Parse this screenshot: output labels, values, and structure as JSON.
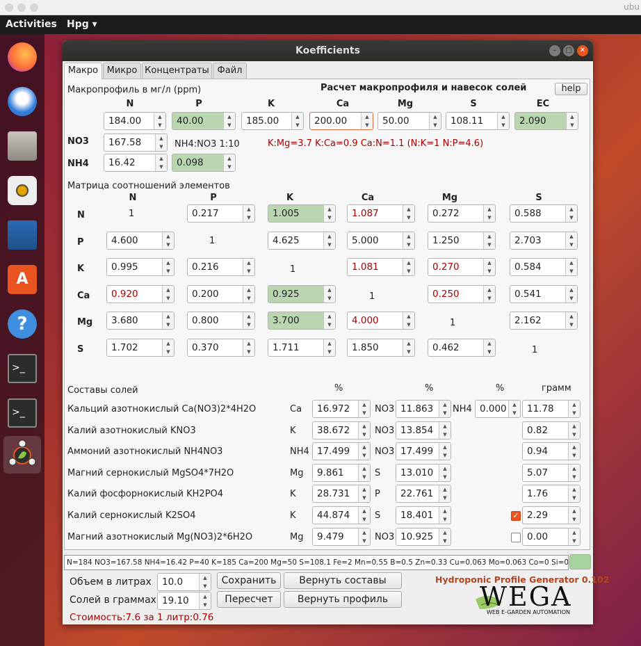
{
  "browser_chrome": {
    "title": "ubu"
  },
  "topbar": {
    "activities": "Activities",
    "app_menu": "Hpg ▾"
  },
  "dock": {
    "items": [
      "firefox-icon",
      "thunderbird-icon",
      "files-icon",
      "rhythmbox-icon",
      "writer-icon",
      "software-icon",
      "help-icon",
      "terminal-icon",
      "terminal-icon",
      "npk-app-icon"
    ]
  },
  "window": {
    "title": "Koefficients",
    "controls": [
      "–",
      "▢",
      "✕"
    ]
  },
  "tabs": [
    {
      "label": "Макро",
      "active": true
    },
    {
      "label": "Микро"
    },
    {
      "label": "Концентраты"
    },
    {
      "label": "Файл"
    }
  ],
  "macro": {
    "section_label": "Макропрофиль в мг/л (ppm)",
    "calc_title": "Расчет макропрофиля и навесок солей",
    "help_label": "help",
    "headers": [
      "N",
      "P",
      "K",
      "Ca",
      "Mg",
      "S",
      "EC"
    ],
    "values": [
      "184.00",
      "40.00",
      "185.00",
      "200.00",
      "50.00",
      "108.11",
      "2.090"
    ],
    "no3_label": "NO3",
    "no3_value": "167.58",
    "nh4_label": "NH4",
    "nh4_value": "16.42",
    "ratio_label": "NH4:NO3 1:10",
    "ratio_value": "0.098",
    "ratios_text": "K:Mg=3.7 K:Ca=0.9 Ca:N=1.1 (N:K=1 N:P=4.6)"
  },
  "matrix": {
    "title": "Матрица соотношений элементов",
    "cols": [
      "N",
      "P",
      "K",
      "Ca",
      "Mg",
      "S"
    ],
    "rows": [
      {
        "label": "N",
        "cells": [
          "1",
          "0.217",
          "1.005",
          "1.087",
          "0.272",
          "0.588"
        ]
      },
      {
        "label": "P",
        "cells": [
          "4.600",
          "1",
          "4.625",
          "5.000",
          "1.250",
          "2.703"
        ]
      },
      {
        "label": "K",
        "cells": [
          "0.995",
          "0.216",
          "1",
          "1.081",
          "0.270",
          "0.584"
        ]
      },
      {
        "label": "Ca",
        "cells": [
          "0.920",
          "0.200",
          "0.925",
          "1",
          "0.250",
          "0.541"
        ]
      },
      {
        "label": "Mg",
        "cells": [
          "3.680",
          "0.800",
          "3.700",
          "4.000",
          "1",
          "2.162"
        ]
      },
      {
        "label": "S",
        "cells": [
          "1.702",
          "0.370",
          "1.711",
          "1.850",
          "0.462",
          "1"
        ]
      }
    ]
  },
  "salts": {
    "title": "Составы солей",
    "col_pct": "%",
    "col_gram": "грамм",
    "rows": [
      {
        "name": "Кальций азотнокислый Ca(NO3)2*4H2O",
        "e1": "Ca",
        "p1": "16.972",
        "e2": "NO3",
        "p2": "11.863",
        "e3": "NH4",
        "p3": "0.000",
        "gram": "11.78"
      },
      {
        "name": "Калий азотнокислый KNO3",
        "e1": "K",
        "p1": "38.672",
        "e2": "NO3",
        "p2": "13.854",
        "gram": "0.82"
      },
      {
        "name": "Аммоний азотнокислый NH4NO3",
        "e1": "NH4",
        "p1": "17.499",
        "e2": "NO3",
        "p2": "17.499",
        "gram": "0.94"
      },
      {
        "name": "Магний сернокислый MgSO4*7H2O",
        "e1": "Mg",
        "p1": "9.861",
        "e2": "S",
        "p2": "13.010",
        "gram": "5.07"
      },
      {
        "name": "Калий фосфорнокислый KH2PO4",
        "e1": "K",
        "p1": "28.731",
        "e2": "P",
        "p2": "22.761",
        "gram": "1.76"
      },
      {
        "name": "Калий сернокислый K2SO4",
        "e1": "K",
        "p1": "44.874",
        "e2": "S",
        "p2": "18.401",
        "gram": "2.29",
        "checked": true
      },
      {
        "name": "Магний азотнокислый Mg(NO3)2*6H2O",
        "e1": "Mg",
        "p1": "9.479",
        "e2": "NO3",
        "p2": "10.925",
        "gram": "0.00",
        "checked": false
      }
    ]
  },
  "status_text": "N=184 NO3=167.58 NH4=16.42 P=40 K=185 Ca=200 Mg=50 S=108.1 Fe=2 Mn=0.55 B=0.5 Zn=0.33 Cu=0.063 Mo=0.063 Co=0 Si=0",
  "bottom": {
    "volume_label": "Объем в литрах",
    "volume_value": "10.0",
    "salts_label": "Солей в граммах:",
    "salts_value": "19.10",
    "save": "Сохранить",
    "restore_comp": "Вернуть составы",
    "recalc": "Пересчет",
    "restore_prof": "Вернуть профиль",
    "cost": "Стоимость:7.6 за 1 литр:0.76",
    "brand": "Hydroponic Profile Generator 0.102",
    "logo": "WEGA",
    "logo_sub": "WEB E-GARDEN AUTOMATION"
  },
  "colors": {
    "accent": "#e95420",
    "green_field": "#b9d6b0",
    "red_text": "#aa0000"
  }
}
